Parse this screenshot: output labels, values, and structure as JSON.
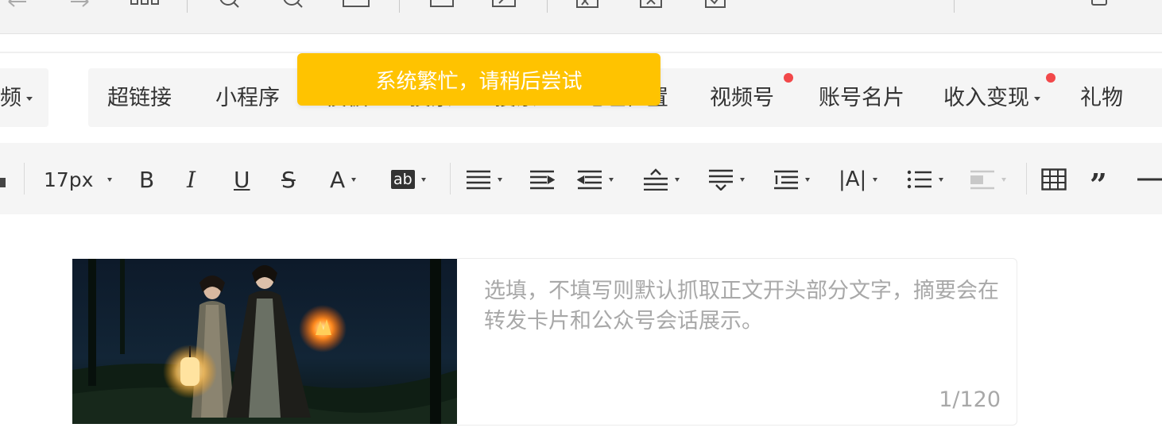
{
  "menu": {
    "partial_left": "频",
    "items": [
      {
        "label": "超链接",
        "has_dropdown": false,
        "dot": false
      },
      {
        "label": "小程序",
        "has_dropdown": false,
        "dot": false
      },
      {
        "label": "模板",
        "has_dropdown": false,
        "dot": false
      },
      {
        "label": "投票",
        "has_dropdown": false,
        "dot": false
      },
      {
        "label": "搜索",
        "has_dropdown": false,
        "dot": false
      },
      {
        "label": "地理位置",
        "has_dropdown": false,
        "dot": false
      },
      {
        "label": "视频号",
        "has_dropdown": false,
        "dot": true
      },
      {
        "label": "账号名片",
        "has_dropdown": false,
        "dot": false
      },
      {
        "label": "收入变现",
        "has_dropdown": true,
        "dot": true
      },
      {
        "label": "礼物",
        "has_dropdown": false,
        "dot": false
      }
    ]
  },
  "toast": {
    "message": "系统繁忙，请稍后尝试",
    "color": "#ffc300"
  },
  "format_toolbar": {
    "font_size": "17px",
    "bold": "B",
    "italic": "I",
    "underline": "U",
    "strike": "S",
    "font_color": "A",
    "highlight": "ab"
  },
  "editor": {
    "summary_placeholder": "选填，不填写则默认抓取正文开头部分文字，摘要会在转发卡片和公众号会话展示。",
    "counter": "1/120"
  },
  "colors": {
    "accent_dot": "#f2484a",
    "toast": "#ffc300",
    "toolbar_bg": "#f5f5f5"
  }
}
